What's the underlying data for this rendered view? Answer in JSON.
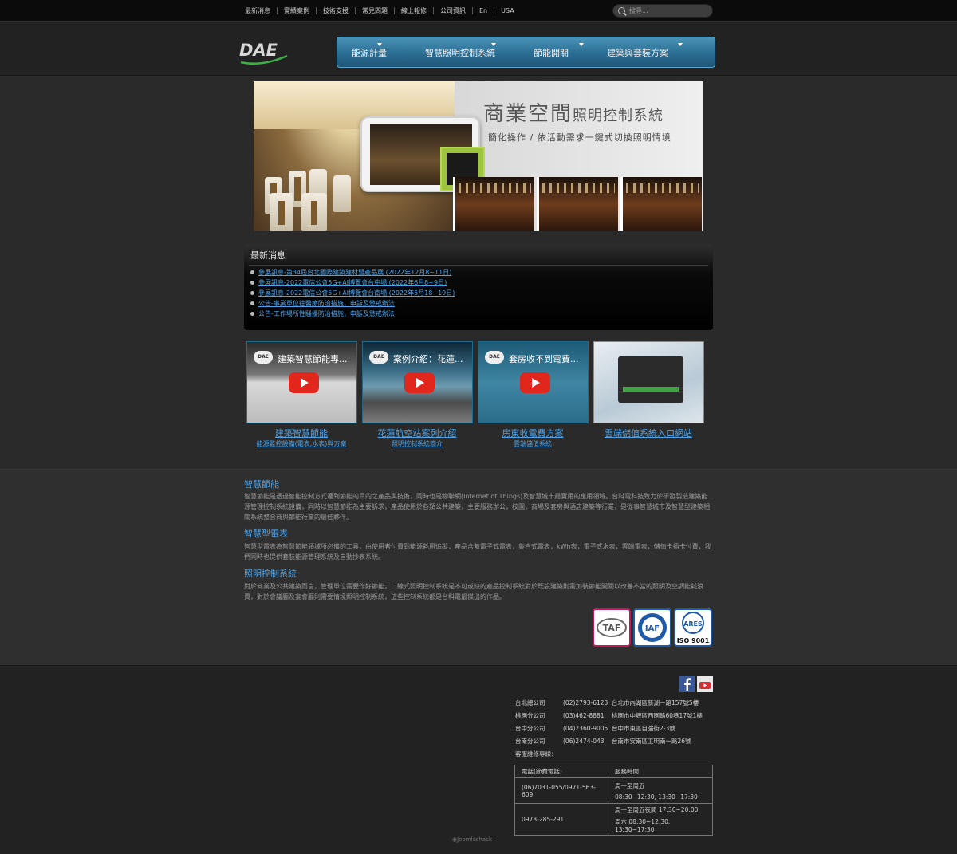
{
  "topnav": [
    "最新消息",
    "實績案例",
    "技術支援",
    "常見問題",
    "線上報修",
    "公司資訊",
    "En",
    "USA"
  ],
  "search": {
    "placeholder": "搜尋..."
  },
  "logo": {
    "text": "DAE"
  },
  "mainnav": [
    "能源計量",
    "智慧照明控制系統",
    "節能開關",
    "建築與套裝方案"
  ],
  "banner": {
    "title_big": "商業空間",
    "title_small": "照明控制系統",
    "subtitle": "簡化操作 / 依活動需求一鍵式切換照明情境"
  },
  "news": {
    "heading": "最新消息",
    "items": [
      "參展訊息-第34屆台北國際建築建材暨產品展 (2022年12月8~11日)",
      "參展訊息-2022電信公會5G+AI博覽會台中場 (2022年6月8~9日)",
      "參展訊息-2022電信公會5G+AI博覽會台南場 (2022年5月18~19日)",
      "公告-事業單位往醫療防治措施，申訴及懲戒辦法",
      "公告-工作場所性騷擾防治措施，申訴及懲戒辦法"
    ]
  },
  "videos": [
    {
      "thumb_title": "建築智慧節能專...",
      "caption": "建築智慧節能",
      "sub": "能源監控設備(電表,水表)與方案"
    },
    {
      "thumb_title": "案例介紹：花蓮...",
      "caption": "花蓮航空站案列介紹",
      "sub": "照明控制系統簡介"
    },
    {
      "thumb_title": "套房收不到電費...",
      "caption": "房東收電費方案",
      "sub": "雲端儲值系統"
    },
    {
      "thumb_title": "",
      "caption": "雲端儲值系統入口網站",
      "sub": ""
    }
  ],
  "video_channel_label": "DAE",
  "about": [
    {
      "heading": "智慧節能",
      "text": "智慧節能是透過智能控制方式達到節能的目的之產品與技術，同時也是物聯網(Internet of Things)及智慧城市最實用的應用領域。台科電科技致力於研發製造建築能源管理控制系統設備，同時以智慧節能為主要訴求，產品使用於各類公共建築，主要服務辦公，校園，商場及套房與酒店建築等行業，是從事智慧城市及智慧型建築相關系統整合商與節能行業的最佳夥伴。"
    },
    {
      "heading": "智慧型電表",
      "text": "智慧型電表為智慧節能領域所必備的工具，由使用者付費到能源耗用追蹤，產品含蓋電子式電表，集合式電表，kWh表，電子式水表，雲端電表，儲值卡插卡付費，我們同時也提供套裝能源管理系統及自動抄表系統。"
    },
    {
      "heading": "照明控制系統",
      "text": "對於商業及公共建築而言，管理單位需要作好節能，二線式照明控制系統是不可或缺的產品控制系統對於既設建築則需加裝節能開關以改善不當的照明及空調能耗浪費，對於會議廳及宴會廳則需要情境照明控制系統，這些控制系統都是台科電最傑出的作品。"
    }
  ],
  "badges": [
    "TAF",
    "IAF",
    "ARES ISO 9001"
  ],
  "branches": [
    {
      "name": "台北總公司",
      "phone": "(02)2793-6123",
      "address": "台北市內湖區新湖一路157號5樓"
    },
    {
      "name": "桃園分公司",
      "phone": "(03)462-8881",
      "address": "桃園市中壢區西園路60巷17號1樓"
    },
    {
      "name": "台中分公司",
      "phone": "(04)2360-9005",
      "address": "台中市東區自強街2-3號"
    },
    {
      "name": "台南分公司",
      "phone": "(06)2474-043",
      "address": "台南市安南區工明南一路26號"
    }
  ],
  "service": {
    "label": "客服維修專線：",
    "headers": [
      "電話(節費電話)",
      "服務時間"
    ],
    "rows": [
      {
        "phone": "(06)7031-055/0971-563-609",
        "time1": "周一至周五",
        "time2": "08:30~12:30, 13:30~17:30"
      },
      {
        "phone": "0973-285-291",
        "time1": "周一至周五夜間 17:30~20:00",
        "time2": "周六 08:30~12:30, 13:30~17:30"
      }
    ]
  },
  "credit": "Joomlashack",
  "colors": {
    "link": "#4ea3e8",
    "nav_blue": "#2b6d93",
    "youtube_red": "#e1261c",
    "bg": "#2a2a2a"
  }
}
